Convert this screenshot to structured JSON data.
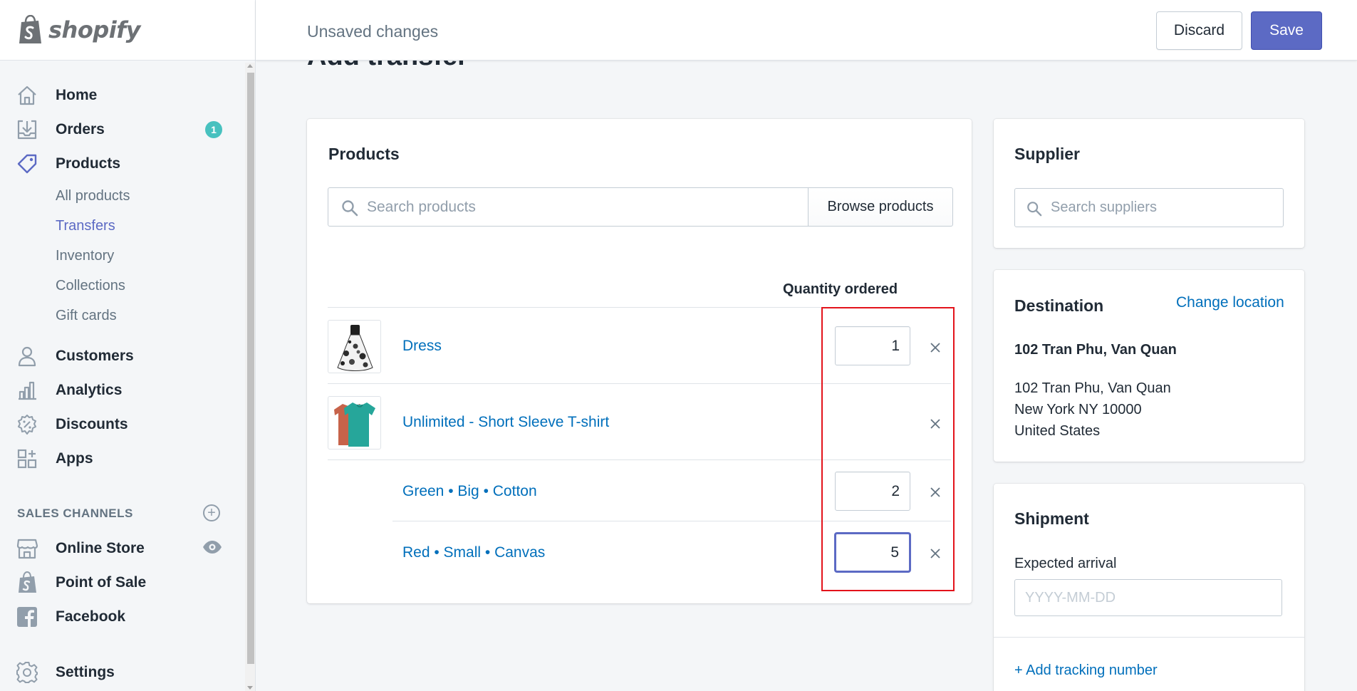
{
  "brand": {
    "name": "shopify"
  },
  "sidebar": {
    "nav": [
      {
        "label": "Home",
        "icon": "home-icon"
      },
      {
        "label": "Orders",
        "icon": "orders-icon",
        "badge": "1"
      },
      {
        "label": "Products",
        "icon": "tag-icon"
      }
    ],
    "product_sub": [
      "All products",
      "Transfers",
      "Inventory",
      "Collections",
      "Gift cards"
    ],
    "active_sub": "Transfers",
    "nav2": [
      {
        "label": "Customers",
        "icon": "customer-icon"
      },
      {
        "label": "Analytics",
        "icon": "analytics-icon"
      },
      {
        "label": "Discounts",
        "icon": "discount-icon"
      },
      {
        "label": "Apps",
        "icon": "apps-icon"
      }
    ],
    "sales_channels_title": "SALES CHANNELS",
    "channels": [
      {
        "label": "Online Store",
        "icon": "store-icon"
      },
      {
        "label": "Point of Sale",
        "icon": "pos-icon"
      },
      {
        "label": "Facebook",
        "icon": "facebook-icon"
      }
    ],
    "settings_label": "Settings"
  },
  "topbar": {
    "title": "Unsaved changes",
    "discard_label": "Discard",
    "save_label": "Save"
  },
  "page": {
    "title": "Add transfer"
  },
  "products_card": {
    "title": "Products",
    "search_placeholder": "Search products",
    "browse_label": "Browse products",
    "qty_header": "Quantity ordered",
    "rows": [
      {
        "name": "Dress",
        "qty": "1"
      },
      {
        "name": "Unlimited - Short Sleeve T-shirt",
        "qty": ""
      },
      {
        "variant": "Green • Big • Cotton",
        "qty": "2"
      },
      {
        "variant": "Red • Small • Canvas",
        "qty": "5"
      }
    ]
  },
  "supplier_card": {
    "title": "Supplier",
    "search_placeholder": "Search suppliers"
  },
  "destination_card": {
    "title": "Destination",
    "change_label": "Change location",
    "name": "102 Tran Phu, Van Quan",
    "address_lines": [
      "102 Tran Phu, Van Quan",
      "New York NY 10000",
      "United States"
    ]
  },
  "shipment_card": {
    "title": "Shipment",
    "expected_label": "Expected arrival",
    "date_placeholder": "YYYY-MM-DD",
    "tracking_label": "+ Add tracking number"
  },
  "colors": {
    "accent": "#5c6ac4",
    "link": "#006fbb",
    "badge": "#47c1bf",
    "highlight": "#e3131b"
  }
}
